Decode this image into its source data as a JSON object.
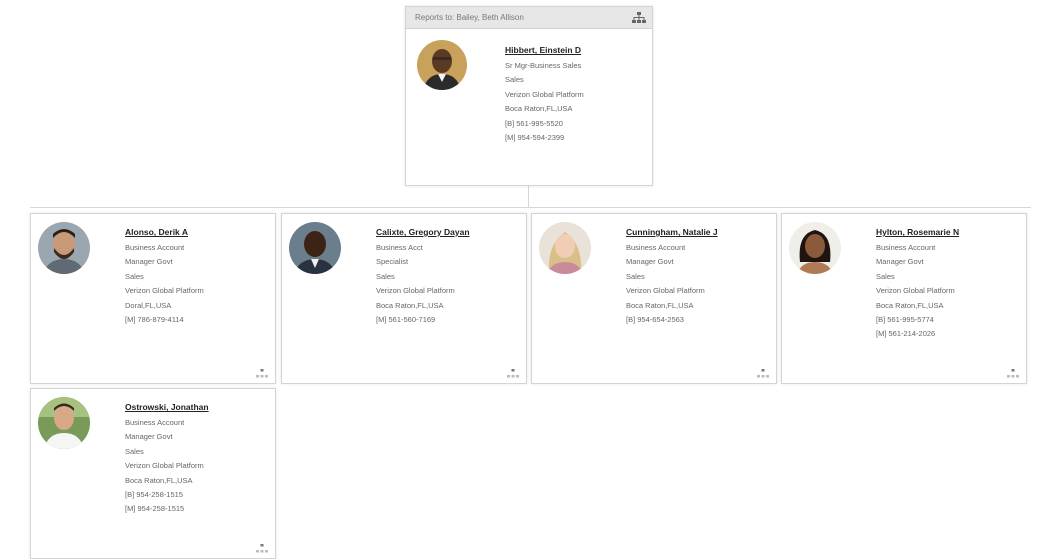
{
  "manager": {
    "reports_to": "Reports to: Bailey, Beth Allison",
    "name": "Hibbert, Einstein D",
    "title": "Sr Mgr-Business Sales",
    "department": "Sales",
    "org": "Verizon Global Platform",
    "location": "Boca Raton,FL,USA",
    "phone_business": "[B] 561-995-5520",
    "phone_mobile": "[M] 954-594-2399"
  },
  "reports": [
    {
      "name": "Alonso, Derik A",
      "lines": [
        "Business Account",
        "Manager Govt",
        "Sales",
        "Verizon Global Platform",
        "Doral,FL,USA",
        "[M] 786-879-4114"
      ]
    },
    {
      "name": "Calixte, Gregory Dayan",
      "lines": [
        "Business Acct",
        "Specialist",
        "Sales",
        "Verizon Global Platform",
        "Boca Raton,FL,USA",
        "[M] 561-560-7169"
      ]
    },
    {
      "name": "Cunningham, Natalie J",
      "lines": [
        "Business Account",
        "Manager Govt",
        "Sales",
        "Verizon Global Platform",
        "Boca Raton,FL,USA",
        "[B] 954-654-2563"
      ]
    },
    {
      "name": "Hylton, Rosemarie N",
      "lines": [
        "Business Account",
        "Manager Govt",
        "Sales",
        "Verizon Global Platform",
        "Boca Raton,FL,USA",
        "[B] 561-995-5774",
        "[M] 561-214-2026"
      ]
    },
    {
      "name": "Ostrowski, Jonathan",
      "lines": [
        "Business Account",
        "Manager Govt",
        "Sales",
        "Verizon Global Platform",
        "Boca Raton,FL,USA",
        "[B] 954-258-1515",
        "[M] 954-258-1515"
      ]
    }
  ],
  "icons": {
    "hierarchy": "org-hierarchy-icon",
    "expand": "expand-reports-icon"
  },
  "colors": {
    "card_border": "#d4d4d4",
    "header_bg": "#e7e7e7",
    "connector": "#d6d6d6"
  }
}
